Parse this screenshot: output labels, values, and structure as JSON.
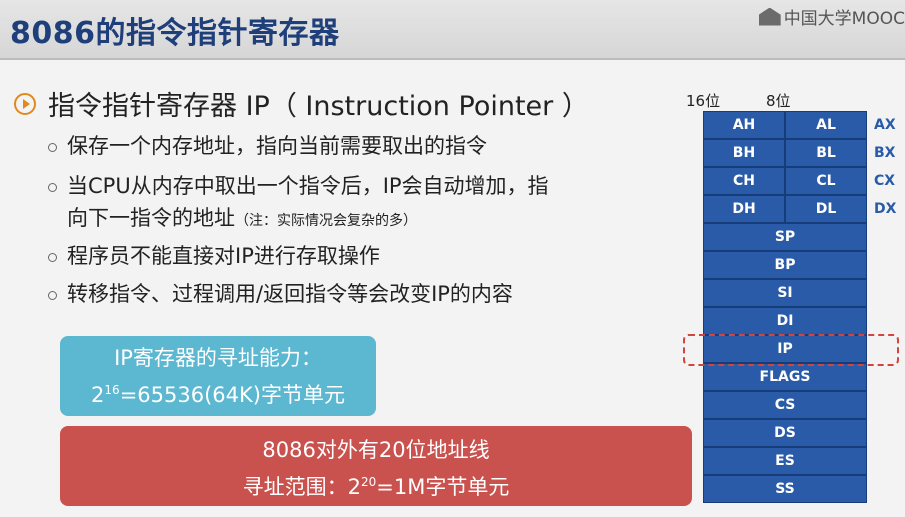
{
  "title": "8086的指令指针寄存器",
  "logo": {
    "text": "中国大学MOOC"
  },
  "heading": "指令指针寄存器 IP（ Instruction Pointer ）",
  "bullets": [
    {
      "text": "保存一个内存地址，指向当前需要取出的指令"
    },
    {
      "text": "当CPU从内存中取出一个指令后，IP会自动增加，指",
      "text2": "向下一指令的地址",
      "note": "（注：实际情况会复杂的多）"
    },
    {
      "text": "程序员不能直接对IP进行存取操作"
    },
    {
      "text": "转移指令、过程调用/返回指令等会改变IP的内容"
    }
  ],
  "blue_box": {
    "line1": "IP寄存器的寻址能力：",
    "base": "2",
    "exp": "16",
    "rest": "=65536(64K)字节单元"
  },
  "red_box": {
    "line1": "8086对外有20位地址线",
    "prefix": "寻址范围：",
    "base": "2",
    "exp": "20",
    "rest": "=1M字节单元"
  },
  "registers": {
    "header_16": "16位",
    "header_8": "8位",
    "pairs": [
      {
        "high": "AH",
        "low": "AL",
        "name": "AX"
      },
      {
        "high": "BH",
        "low": "BL",
        "name": "BX"
      },
      {
        "high": "CH",
        "low": "CL",
        "name": "CX"
      },
      {
        "high": "DH",
        "low": "DL",
        "name": "DX"
      }
    ],
    "singles": [
      "SP",
      "BP",
      "SI",
      "DI",
      "IP",
      "FLAGS",
      "CS",
      "DS",
      "ES",
      "SS"
    ],
    "colors": {
      "register": "#2a5ba8",
      "highlight": "#d0453f"
    }
  }
}
